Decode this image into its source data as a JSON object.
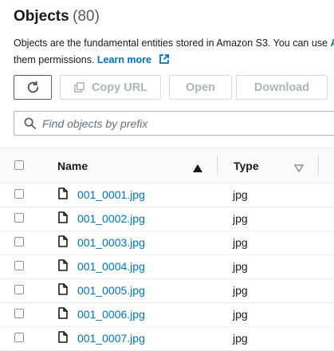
{
  "header": {
    "title": "Objects",
    "count": "(80)"
  },
  "description": {
    "line1": "Objects are the fundamental entities stored in Amazon S3. You can use",
    "line1_clipped": "Am",
    "line2": "them permissions.",
    "learn_more": "Learn more"
  },
  "toolbar": {
    "copy_url": "Copy URL",
    "open": "Open",
    "download": "Download"
  },
  "search": {
    "placeholder": "Find objects by prefix"
  },
  "table": {
    "columns": {
      "name": "Name",
      "type": "Type"
    },
    "rows": [
      {
        "name": "001_0001.jpg",
        "type": "jpg"
      },
      {
        "name": "001_0002.jpg",
        "type": "jpg"
      },
      {
        "name": "001_0003.jpg",
        "type": "jpg"
      },
      {
        "name": "001_0004.jpg",
        "type": "jpg"
      },
      {
        "name": "001_0005.jpg",
        "type": "jpg"
      },
      {
        "name": "001_0006.jpg",
        "type": "jpg"
      },
      {
        "name": "001_0007.jpg",
        "type": "jpg"
      }
    ]
  },
  "colors": {
    "link": "#0073bb",
    "text": "#16191f",
    "disabled": "#aab7b8"
  }
}
